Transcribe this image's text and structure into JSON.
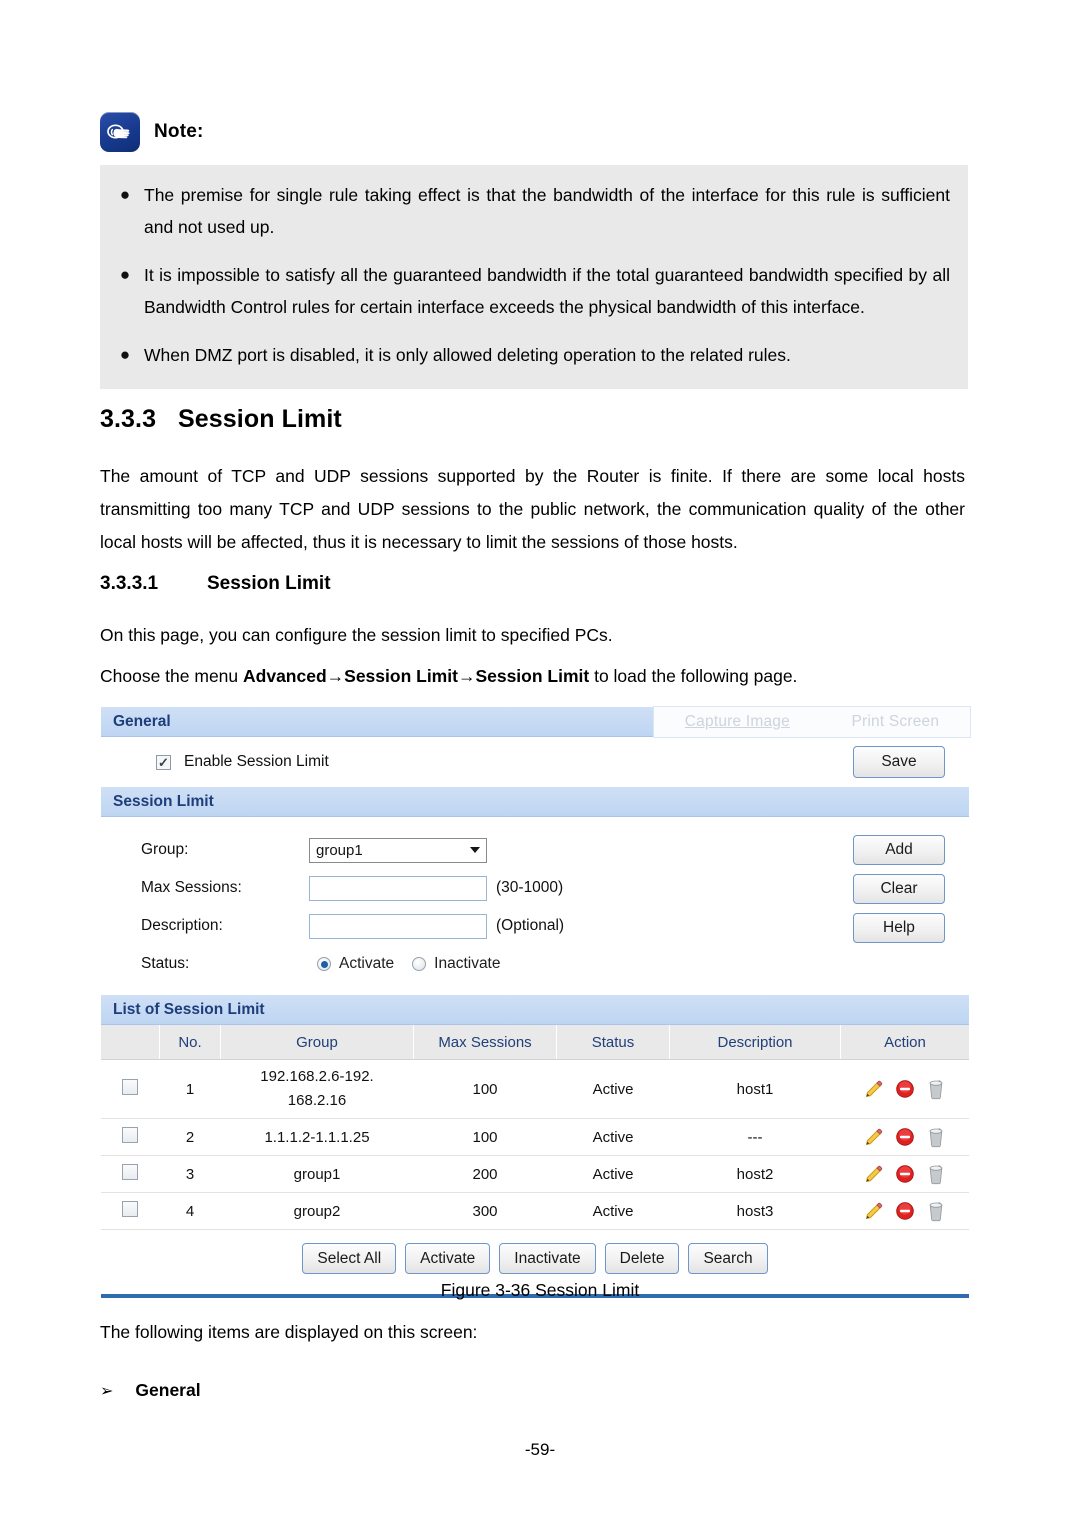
{
  "note": {
    "icon": "pointing-hand-icon",
    "title": "Note:",
    "bullets": [
      "The premise for single rule taking effect is that the bandwidth of the interface for this rule is sufficient and not used up.",
      "It is impossible to satisfy all the guaranteed bandwidth if the total guaranteed bandwidth specified by all Bandwidth Control rules for certain interface exceeds the physical bandwidth of this interface.",
      "When DMZ port is disabled, it is only allowed deleting operation to the related rules."
    ]
  },
  "headings": {
    "h3_number": "3.3.3",
    "h3_title": "Session Limit",
    "h4_number": "3.3.3.1",
    "h4_title": "Session Limit"
  },
  "paragraphs": {
    "intro": "The amount of TCP and UDP sessions supported by the Router is finite. If there are some local hosts transmitting too many TCP and UDP sessions to the public network, the communication quality of the other local hosts will be affected, thus it is necessary to limit the sessions of those hosts.",
    "page_desc": "On this page, you can configure the session limit to specified PCs.",
    "menu_prefix": "Choose the menu ",
    "menu_path_1": "Advanced",
    "menu_arrow_1": "→",
    "menu_path_2": "Session Limit",
    "menu_arrow_2": "→",
    "menu_path_3": "Session Limit",
    "menu_suffix": " to load the following page.",
    "following_items": "The following items are displayed on this screen:",
    "general_item": "General",
    "general_arrow": "➢"
  },
  "ghost_toolbar": {
    "capture_image": "Capture Image",
    "print_screen": "Print Screen"
  },
  "ui": {
    "general_section": {
      "title": "General",
      "enable_label": "Enable Session Limit",
      "enable_checked": true,
      "save_label": "Save"
    },
    "session_limit_section": {
      "title": "Session Limit",
      "group_label": "Group:",
      "group_value": "group1",
      "max_sessions_label": "Max Sessions:",
      "max_sessions_value": "",
      "max_sessions_hint": "(30-1000)",
      "description_label": "Description:",
      "description_value": "",
      "description_hint": "(Optional)",
      "status_label": "Status:",
      "status_activate": "Activate",
      "status_inactivate": "Inactivate",
      "status_selected": "Activate",
      "add_label": "Add",
      "clear_label": "Clear",
      "help_label": "Help"
    },
    "list_section": {
      "title": "List of Session Limit",
      "columns": [
        "",
        "No.",
        "Group",
        "Max Sessions",
        "Status",
        "Description",
        "Action"
      ],
      "rows": [
        {
          "no": "1",
          "group": "192.168.2.6-192.\n168.2.16",
          "max_sessions": "100",
          "status": "Active",
          "description": "host1"
        },
        {
          "no": "2",
          "group": "1.1.1.2-1.1.1.25",
          "max_sessions": "100",
          "status": "Active",
          "description": "---"
        },
        {
          "no": "3",
          "group": "group1",
          "max_sessions": "200",
          "status": "Active",
          "description": "host2"
        },
        {
          "no": "4",
          "group": "group2",
          "max_sessions": "300",
          "status": "Active",
          "description": "host3"
        }
      ],
      "row_action_icons": [
        "edit-pencil-icon",
        "disable-circle-icon",
        "delete-trash-icon"
      ],
      "buttons": [
        "Select All",
        "Activate",
        "Inactivate",
        "Delete",
        "Search"
      ]
    }
  },
  "figure_caption": "Figure 3-36 Session Limit",
  "page_number": "-59-",
  "colors": {
    "section_header_bg": "#c5d9f1",
    "section_header_text": "#1f3d7a",
    "table_header_bg": "#e9e9e9",
    "table_header_text": "#20407a",
    "note_bg": "#e9e9e9",
    "note_icon_bg": "#173a8f",
    "bottom_rule": "#2e6bb0",
    "button_border": "#6f96c8",
    "radio_dot": "#1d5fa8",
    "icon_pencil": "#f0b429",
    "icon_disable": "#e02020",
    "icon_trash": "#b9bcbe"
  }
}
